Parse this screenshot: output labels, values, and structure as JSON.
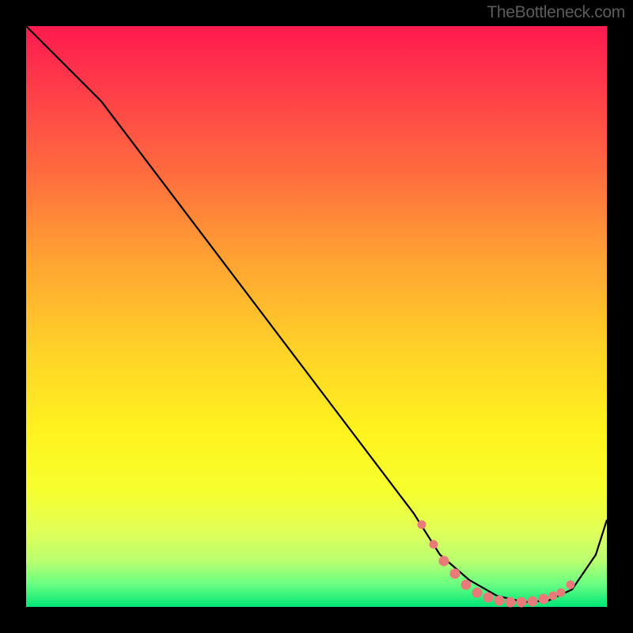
{
  "attribution": "TheBottleneck.com",
  "chart_data": {
    "type": "line",
    "title": "",
    "xlabel": "",
    "ylabel": "",
    "xlim": [
      0,
      100
    ],
    "ylim": [
      0,
      100
    ],
    "background": "heatmap-gradient",
    "series": [
      {
        "name": "bottleneck-curve",
        "x": [
          0,
          5,
          10,
          20,
          30,
          40,
          50,
          60,
          65,
          70,
          75,
          80,
          85,
          90,
          95,
          100
        ],
        "y": [
          100,
          94,
          88,
          75,
          62,
          49,
          36,
          22,
          15,
          8,
          3,
          1,
          0.5,
          1,
          6,
          15
        ],
        "color": "#000000"
      }
    ],
    "markers": {
      "name": "highlighted-range",
      "color": "#e97a7a",
      "points_x": [
        68,
        71,
        73,
        75,
        77,
        79,
        81,
        83,
        85,
        87,
        89,
        90,
        91
      ],
      "points_y": [
        9,
        6,
        4,
        2,
        1,
        0.8,
        0.6,
        0.6,
        0.6,
        0.8,
        1.5,
        2.5,
        4
      ]
    },
    "color_scale": {
      "low": "#00e676",
      "mid": "#fff31e",
      "high": "#ff1a4f"
    }
  }
}
